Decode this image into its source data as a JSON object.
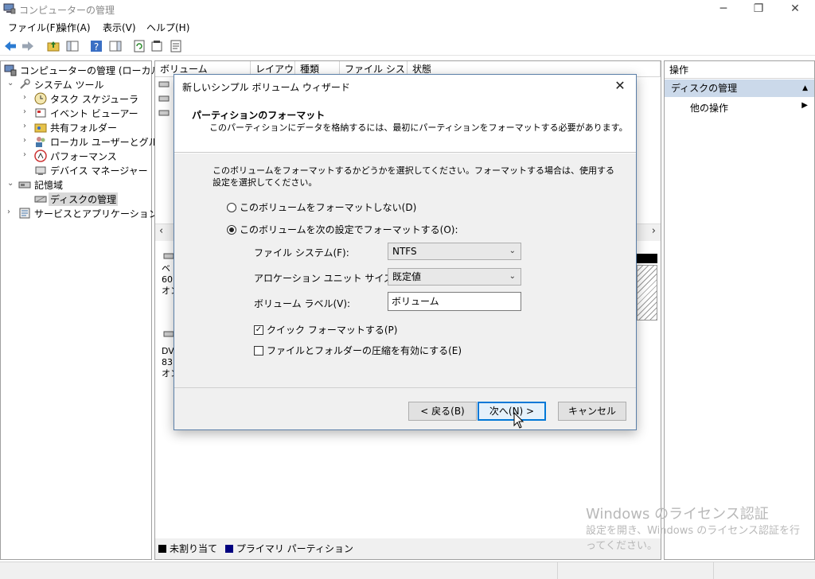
{
  "window": {
    "title": "コンピューターの管理",
    "minimize": "─",
    "restore": "❐",
    "close": "✕"
  },
  "menu": [
    "ファイル(F)",
    "操作(A)",
    "表示(V)",
    "ヘルプ(H)"
  ],
  "tree": {
    "root": "コンピューターの管理 (ローカル)",
    "system_tools": "システム ツール",
    "task_scheduler": "タスク スケジューラ",
    "event_viewer": "イベント ビューアー",
    "shared_folders": "共有フォルダー",
    "local_users": "ローカル ユーザーとグループ",
    "performance": "パフォーマンス",
    "device_manager": "デバイス マネージャー",
    "storage": "記憶域",
    "disk_management": "ディスクの管理",
    "services_apps": "サービスとアプリケーション"
  },
  "columns": [
    "ボリューム",
    "レイアウト",
    "種類",
    "ファイル システム",
    "状態"
  ],
  "disk_labels": {
    "disk0": [
      "ベ",
      "60.",
      "オン"
    ],
    "disk1": [
      "DV",
      "83",
      "オン"
    ]
  },
  "legend": {
    "unallocated": "未割り当て",
    "primary": "プライマリ パーティション"
  },
  "actions": {
    "header": "操作",
    "section": "ディスクの管理",
    "more": "他の操作"
  },
  "watermark": {
    "line1": "Windows のライセンス認証",
    "line2": "設定を開き、Windows のライセンス認証を行ってください。"
  },
  "dialog": {
    "title": "新しいシンプル ボリューム ウィザード",
    "heading": "パーティションのフォーマット",
    "subheading": "このパーティションにデータを格納するには、最初にパーティションをフォーマットする必要があります。",
    "description": "このボリュームをフォーマットするかどうかを選択してください。フォーマットする場合は、使用する設定を選択してください。",
    "radio_no_format": "このボリュームをフォーマットしない(D)",
    "radio_format": "このボリュームを次の設定でフォーマットする(O):",
    "fs_label": "ファイル システム(F):",
    "fs_value": "NTFS",
    "alloc_label": "アロケーション ユニット サイズ(A):",
    "alloc_value": "既定値",
    "vol_label": "ボリューム ラベル(V):",
    "vol_value": "ボリューム",
    "quick_format": "クイック フォーマットする(P)",
    "quick_format_checked": true,
    "compression": "ファイルとフォルダーの圧縮を有効にする(E)",
    "compression_checked": false,
    "back": "< 戻る(B)",
    "next": "次へ(N) >",
    "cancel": "キャンセル"
  },
  "colors": {
    "accent": "#0078d7",
    "primary_partition": "#00007f",
    "selection": "#cbd9ea"
  }
}
